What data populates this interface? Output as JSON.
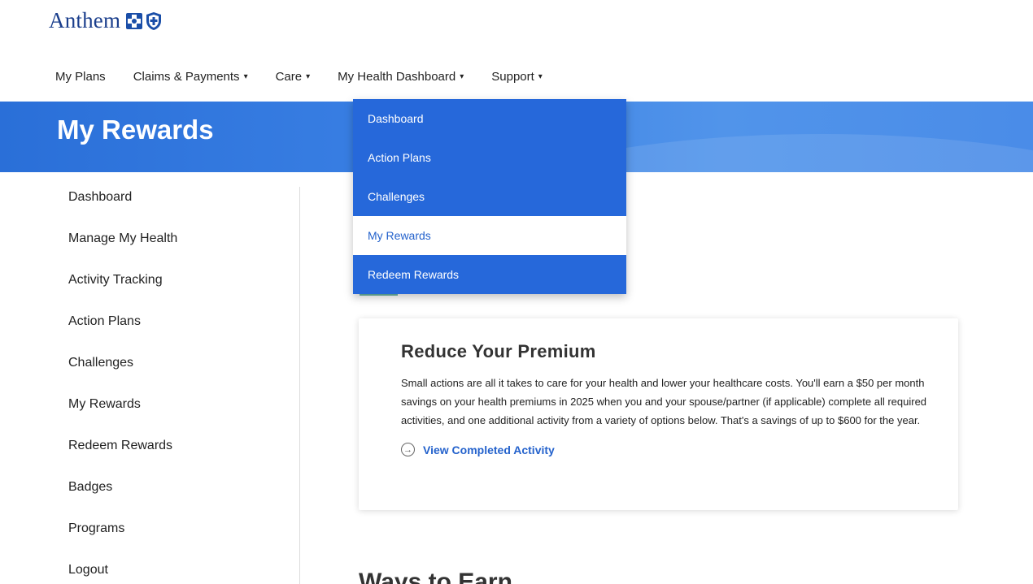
{
  "brand": {
    "name": "Anthem"
  },
  "topnav": {
    "items": [
      {
        "label": "My Plans",
        "has_caret": false
      },
      {
        "label": "Claims & Payments",
        "has_caret": true
      },
      {
        "label": "Care",
        "has_caret": true
      },
      {
        "label": "My Health Dashboard",
        "has_caret": true
      },
      {
        "label": "Support",
        "has_caret": true
      }
    ],
    "caret": "▾"
  },
  "hero": {
    "title": "My Rewards"
  },
  "dropdown": {
    "items": [
      {
        "label": "Dashboard"
      },
      {
        "label": "Action Plans"
      },
      {
        "label": "Challenges"
      },
      {
        "label": "My Rewards",
        "active": true
      },
      {
        "label": "Redeem Rewards"
      }
    ]
  },
  "sidebar": {
    "items": [
      {
        "label": "Dashboard"
      },
      {
        "label": "Manage My Health"
      },
      {
        "label": "Activity Tracking"
      },
      {
        "label": "Action Plans"
      },
      {
        "label": "Challenges"
      },
      {
        "label": "My Rewards"
      },
      {
        "label": "Redeem Rewards"
      },
      {
        "label": "Badges"
      },
      {
        "label": "Programs"
      },
      {
        "label": "Logout"
      }
    ]
  },
  "card": {
    "title": "Reduce Your Premium",
    "body": "Small actions are all it takes to care for your health and lower your healthcare costs. You'll earn a $50 per month savings on your health premiums in 2025 when you and your spouse/partner (if applicable) complete all required activities, and one additional activity from a variety of options below. That's a savings of up to $600 for the year.",
    "link_label": "View Completed Activity",
    "link_icon": "→"
  },
  "section": {
    "heading": "Ways to Earn"
  },
  "colors": {
    "brand_navy": "#1a3e8c",
    "hero_blue": "#2a6fd8",
    "dropdown_blue": "#2668da",
    "link_blue": "#2462cc"
  }
}
